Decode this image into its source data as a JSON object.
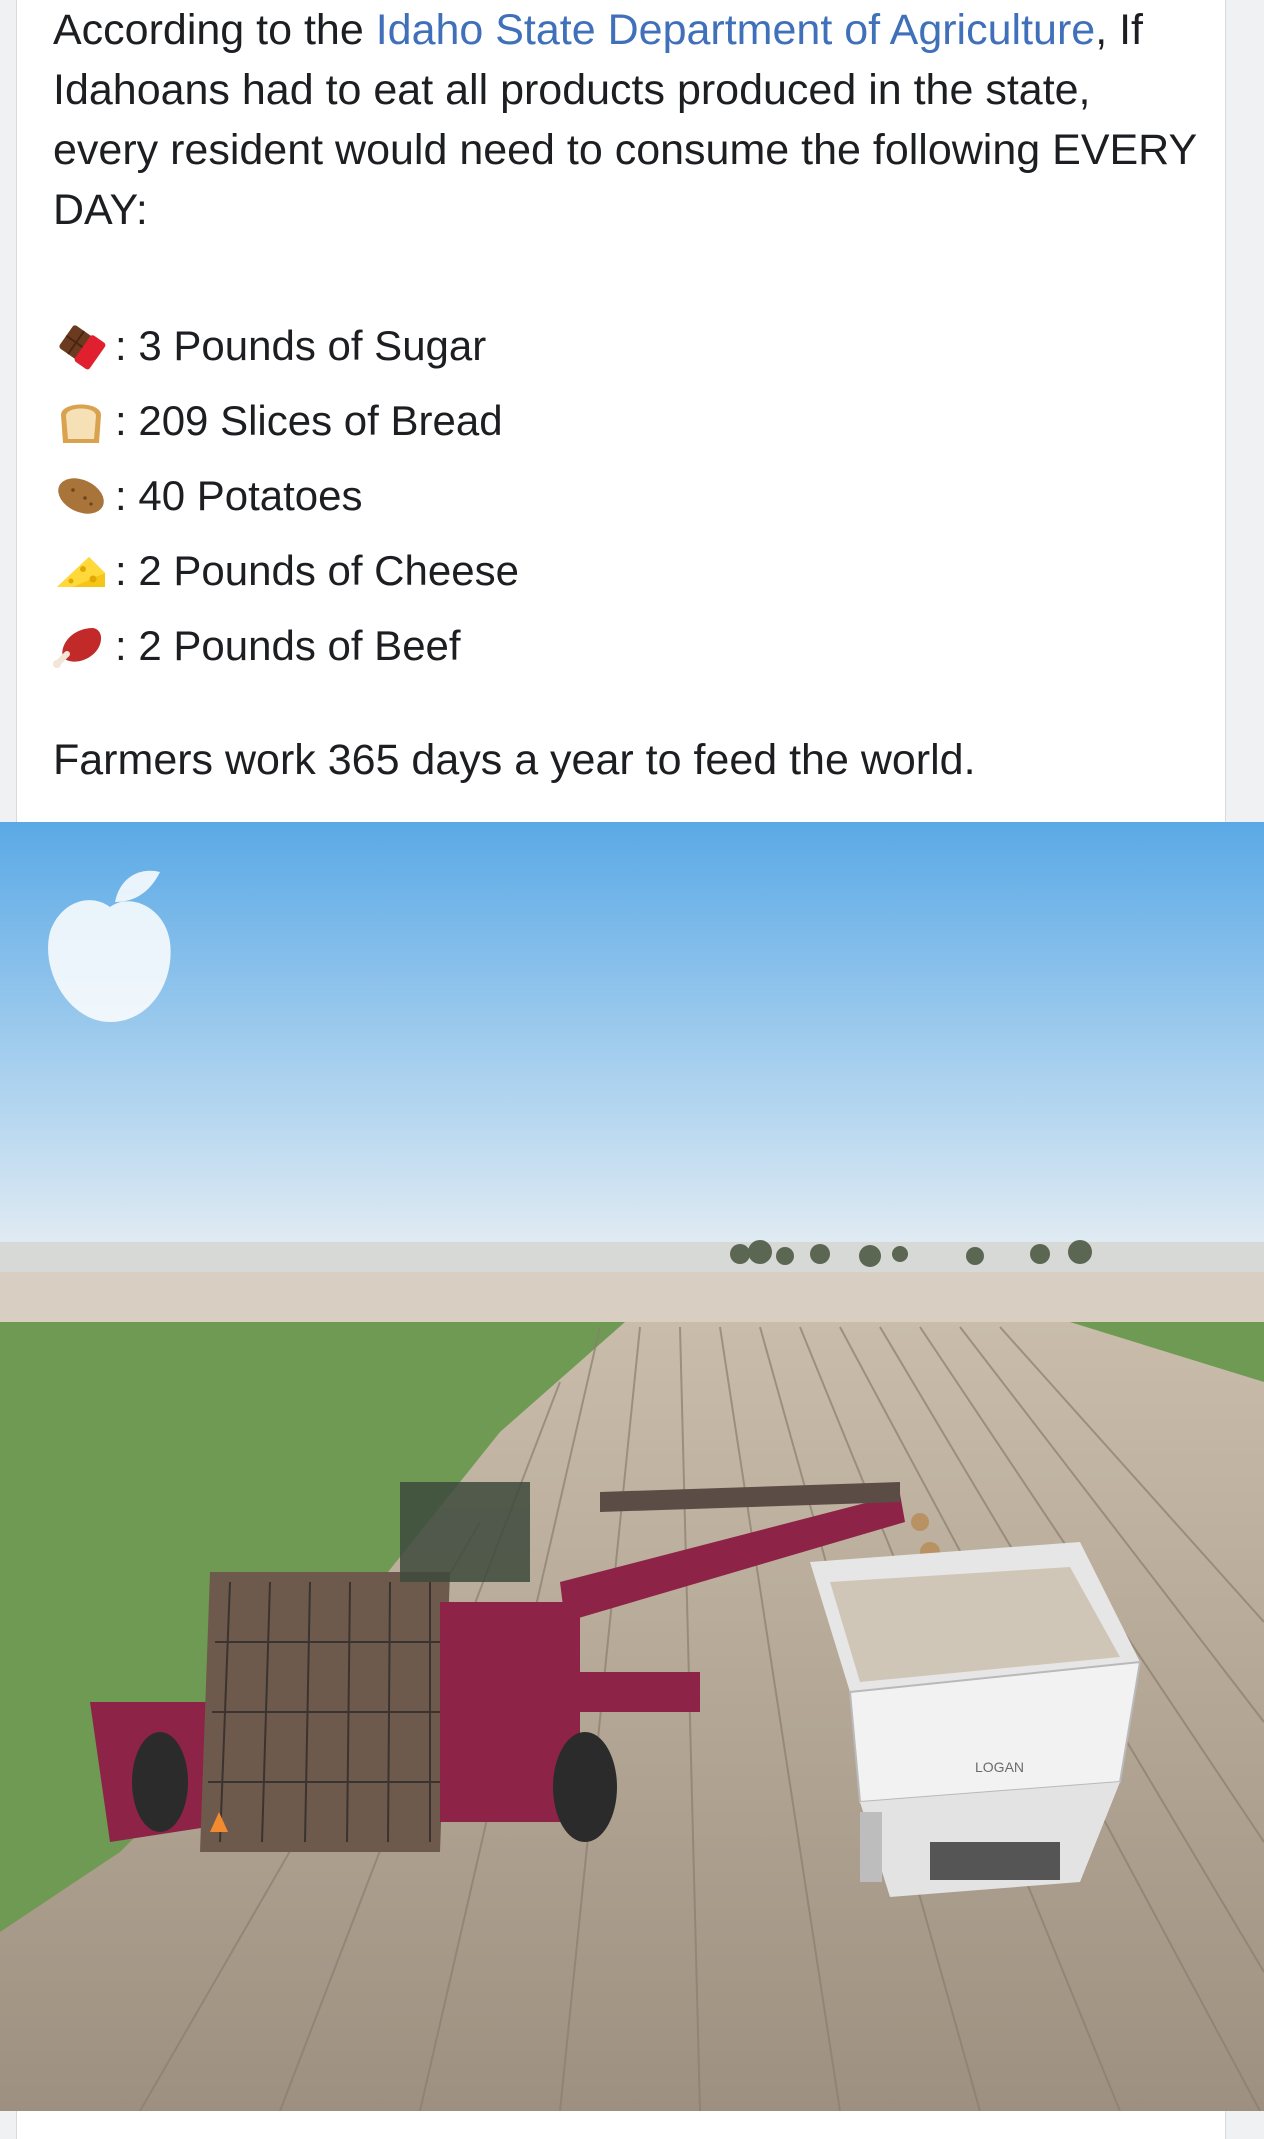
{
  "post": {
    "intro_before": "According to the ",
    "link_text": "Idaho State Department of Agriculture",
    "intro_after": ", If Idahoans had to eat all products produced in the state, every resident would need to consume the following EVERY DAY:",
    "items": [
      {
        "icon": "chocolate-bar-icon",
        "text": ": 3 Pounds of Sugar"
      },
      {
        "icon": "bread-icon",
        "text": ": 209 Slices of Bread"
      },
      {
        "icon": "potato-icon",
        "text": ": 40 Potatoes"
      },
      {
        "icon": "cheese-icon",
        "text": ": 2 Pounds of Cheese"
      },
      {
        "icon": "meat-icon",
        "text": ": 2 Pounds of Beef"
      }
    ],
    "closing": "Farmers work 365 days a year to feed the world."
  },
  "photo": {
    "truck_label": "LOGAN"
  },
  "colors": {
    "link": "#3f70b9",
    "text": "#1c1e21",
    "sky_top": "#5aa9e6",
    "soil": "#a79c8d",
    "crop": "#6e9a53",
    "harvester": "#8d2346"
  }
}
